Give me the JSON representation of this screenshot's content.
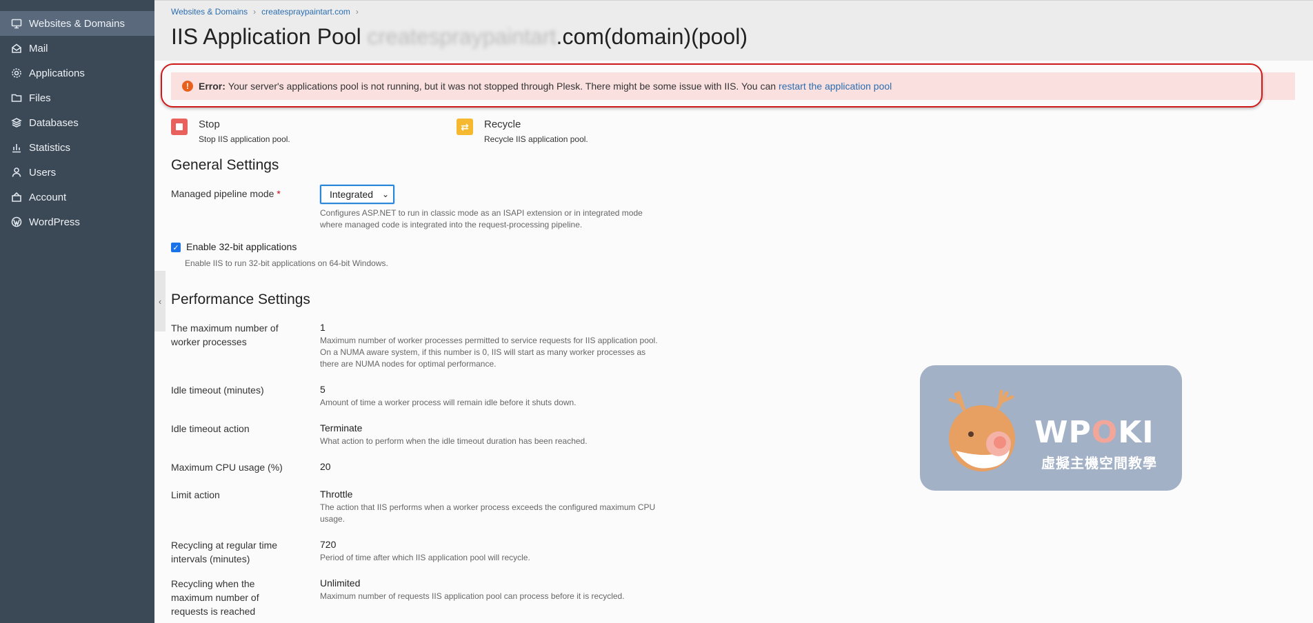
{
  "sidebar": {
    "items": [
      {
        "label": "Websites & Domains",
        "icon": "monitor-icon",
        "active": true
      },
      {
        "label": "Mail",
        "icon": "mail-icon"
      },
      {
        "label": "Applications",
        "icon": "gear-icon"
      },
      {
        "label": "Files",
        "icon": "folder-icon"
      },
      {
        "label": "Databases",
        "icon": "database-icon"
      },
      {
        "label": "Statistics",
        "icon": "bar-chart-icon"
      },
      {
        "label": "Users",
        "icon": "user-icon"
      },
      {
        "label": "Account",
        "icon": "account-icon"
      },
      {
        "label": "WordPress",
        "icon": "wordpress-icon"
      }
    ]
  },
  "breadcrumb": {
    "items": [
      "Websites & Domains",
      "createspraypaintart.com"
    ]
  },
  "page_title": {
    "prefix": "IIS Application Pool ",
    "blurred": "createspraypaintart",
    "suffix": ".com(domain)(pool)"
  },
  "error": {
    "label": "Error:",
    "message": "Your server's applications pool is not running, but it was not stopped through Plesk. There might be some issue with IIS. You can",
    "link": "restart the application pool"
  },
  "actions": [
    {
      "title": "Stop",
      "desc": "Stop IIS application pool.",
      "icon": "stop-icon"
    },
    {
      "title": "Recycle",
      "desc": "Recycle IIS application pool.",
      "icon": "recycle-icon"
    }
  ],
  "general": {
    "title": "General Settings",
    "pipeline_label": "Managed pipeline mode",
    "pipeline_required": "*",
    "pipeline_value": "Integrated",
    "pipeline_desc": "Configures ASP.NET to run in classic mode as an ISAPI extension or in integrated mode where managed code is integrated into the request-processing pipeline.",
    "enable32_label": "Enable 32-bit applications",
    "enable32_checked": true,
    "enable32_desc": "Enable IIS to run 32-bit applications on 64-bit Windows."
  },
  "performance": {
    "title": "Performance Settings",
    "rows": [
      {
        "label": "The maximum number of worker processes",
        "value": "1",
        "desc": "Maximum number of worker processes permitted to service requests for IIS application pool. On a NUMA aware system, if this number is 0, IIS will start as many worker processes as there are NUMA nodes for optimal performance."
      },
      {
        "label": "Idle timeout (minutes)",
        "value": "5",
        "desc": "Amount of time a worker process will remain idle before it shuts down."
      },
      {
        "label": "Idle timeout action",
        "value": "Terminate",
        "desc": "What action to perform when the idle timeout duration has been reached."
      },
      {
        "label": "Maximum CPU usage (%)",
        "value": "20",
        "desc": ""
      },
      {
        "label": "Limit action",
        "value": "Throttle",
        "desc": "The action that IIS performs when a worker process exceeds the configured maximum CPU usage."
      },
      {
        "label": "Recycling at regular time intervals (minutes)",
        "value": "720",
        "desc": "Period of time after which IIS application pool will recycle."
      },
      {
        "label": "Recycling when the maximum number of requests is reached",
        "value": "Unlimited",
        "desc": "Maximum number of requests IIS application pool can process before it is recycled."
      }
    ]
  },
  "watermark": {
    "w": "WP",
    "o": "O",
    "ki": "KI",
    "subtitle": "虛擬主機空間教學"
  },
  "colors": {
    "sidebar": "#3b4856",
    "sidebar_active": "#5a6a7c",
    "error_bg": "#fbe0e0",
    "highlight": "#d01818",
    "link": "#2a6db0"
  }
}
